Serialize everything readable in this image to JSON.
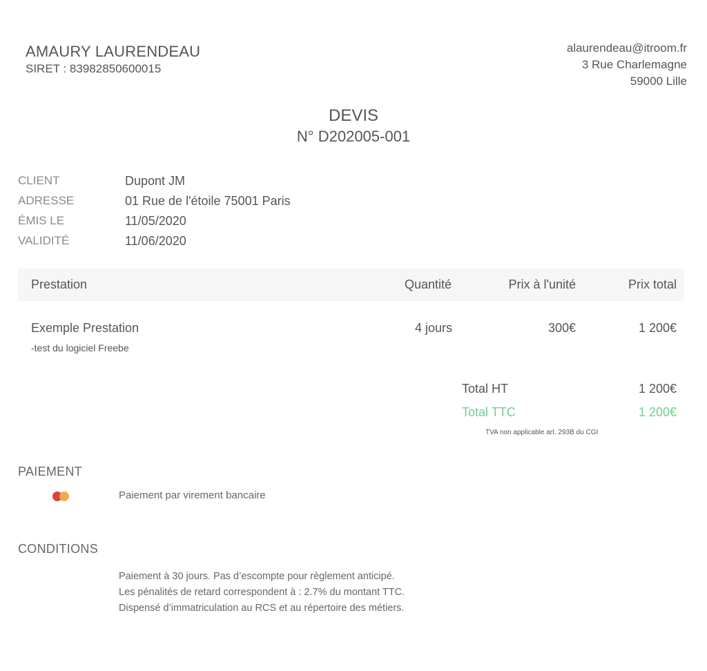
{
  "sender": {
    "name": "AMAURY LAURENDEAU",
    "siret": "SIRET : 83982850600015",
    "email": "alaurendeau@itroom.fr",
    "street": "3 Rue Charlemagne",
    "city": "59000 Lille"
  },
  "document": {
    "title": "DEVIS",
    "number": "N° D202005-001"
  },
  "meta": {
    "client_label": "CLIENT",
    "client_value": "Dupont JM",
    "address_label": "ADRESSE",
    "address_value": "01 Rue de l'étoile 75001 Paris",
    "issued_label": "ÉMIS LE",
    "issued_value": "11/05/2020",
    "validity_label": "VALIDITÉ",
    "validity_value": "11/06/2020"
  },
  "table": {
    "headers": [
      "Prestation",
      "Quantité",
      "Prix à l'unité",
      "Prix total"
    ],
    "rows": [
      {
        "name": "Exemple Prestation",
        "description": "-test du logiciel Freebe",
        "quantity": "4 jours",
        "unit_price": "300€",
        "total": "1 200€"
      }
    ]
  },
  "totals": {
    "ht_label": "Total HT",
    "ht_value": "1 200€",
    "ttc_label": "Total TTC",
    "ttc_value": "1 200€",
    "tva_note": "TVA non applicable art. 293B du CGI",
    "accent_color": "#6ed08a"
  },
  "payment": {
    "title": "PAIEMENT",
    "icon": "card-icon",
    "method": "Paiement par virement bancaire"
  },
  "conditions": {
    "title": "CONDITIONS",
    "lines": [
      "Paiement à 30 jours. Pas d’escompte pour règlement anticipé.",
      "Les pénalités de retard correspondent à : 2.7% du montant TTC.",
      "Dispensé d’immatriculation au RCS et au répertoire des métiers."
    ]
  }
}
